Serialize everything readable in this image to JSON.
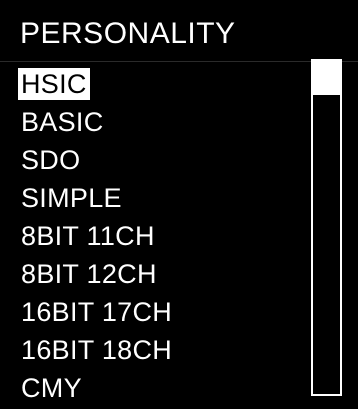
{
  "header": {
    "title": "PERSONALITY"
  },
  "menu": {
    "items": [
      {
        "label": "HSIC"
      },
      {
        "label": "BASIC"
      },
      {
        "label": "SDO"
      },
      {
        "label": "SIMPLE"
      },
      {
        "label": "8BIT 11CH"
      },
      {
        "label": "8BIT 12CH"
      },
      {
        "label": "16BIT 17CH"
      },
      {
        "label": "16BIT 18CH"
      },
      {
        "label": "CMY"
      }
    ],
    "selected_label": "HSIC"
  },
  "colors": {
    "background": "#000000",
    "text": "#ffffff",
    "highlight_background": "#ffffff",
    "highlight_text": "#000000"
  }
}
